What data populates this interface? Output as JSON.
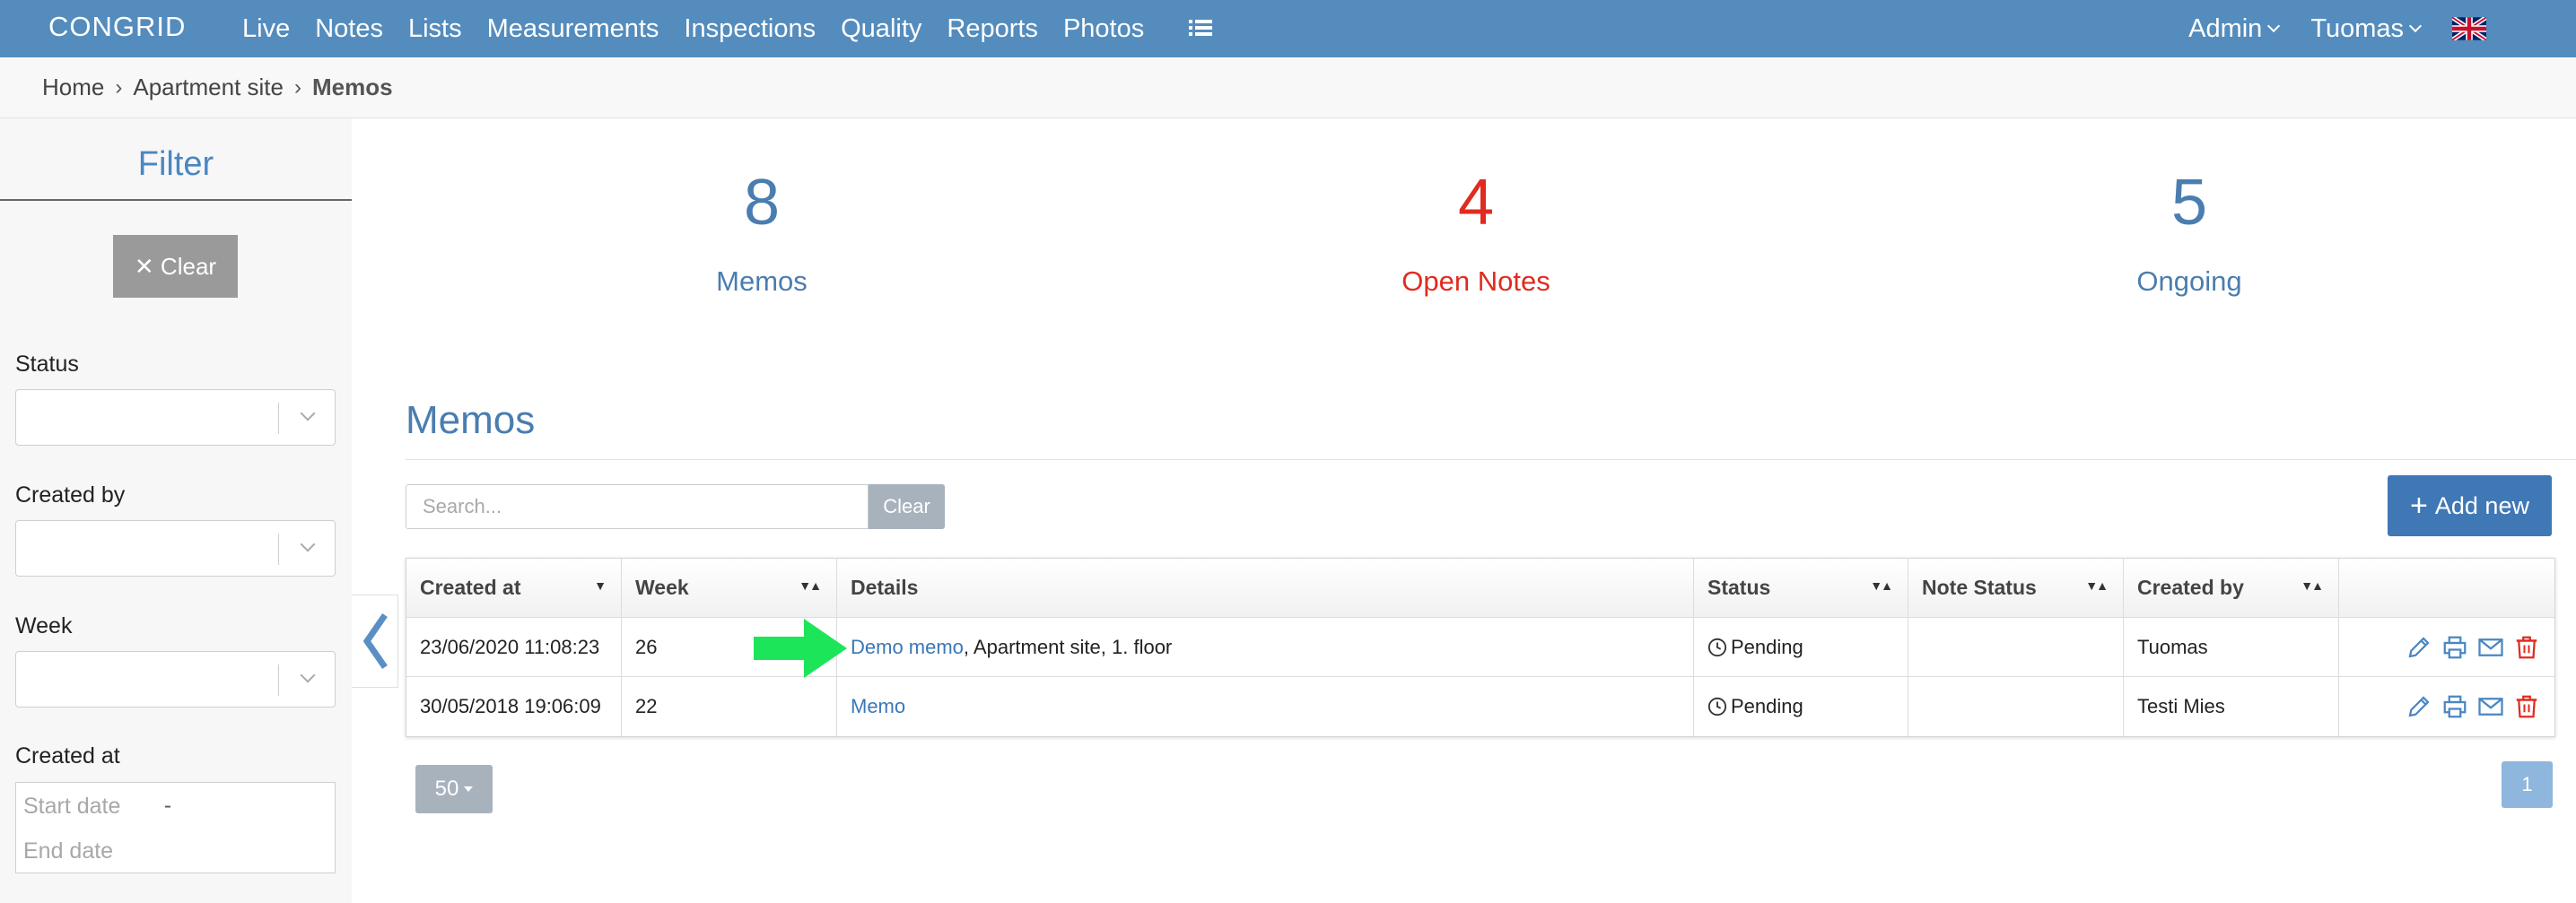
{
  "app": {
    "logo": "CONGRID"
  },
  "nav": {
    "items": [
      "Live",
      "Notes",
      "Lists",
      "Measurements",
      "Inspections",
      "Quality",
      "Reports",
      "Photos"
    ],
    "admin": "Admin",
    "user": "Tuomas"
  },
  "breadcrumb": {
    "home": "Home",
    "site": "Apartment site",
    "current": "Memos"
  },
  "filter": {
    "title": "Filter",
    "clear": "✕ Clear",
    "status_label": "Status",
    "created_by_label": "Created by",
    "week_label": "Week",
    "created_at_label": "Created at",
    "start_placeholder": "Start date",
    "end_placeholder": "End date",
    "date_sep": "-"
  },
  "stats": [
    {
      "value": "8",
      "label": "Memos",
      "color": "#4a7db0"
    },
    {
      "value": "4",
      "label": "Open Notes",
      "color": "#e02b20"
    },
    {
      "value": "5",
      "label": "Ongoing",
      "color": "#4a7db0"
    }
  ],
  "memos": {
    "title": "Memos",
    "search_placeholder": "Search...",
    "search_clear": "Clear",
    "add_new": "Add new",
    "columns": [
      "Created at",
      "Week",
      "Details",
      "Status",
      "Note Status",
      "Created by",
      ""
    ],
    "rows": [
      {
        "created_at": "23/06/2020 11:08:23",
        "week": "26",
        "details_link": "Demo memo",
        "details_rest": ", Apartment site, 1. floor",
        "status": "Pending",
        "note_status": "",
        "created_by": "Tuomas"
      },
      {
        "created_at": "30/05/2018 19:06:09",
        "week": "22",
        "details_link": "Memo",
        "details_rest": "",
        "status": "Pending",
        "note_status": "",
        "created_by": "Testi Mies"
      }
    ],
    "page_size": "50",
    "page": "1"
  }
}
